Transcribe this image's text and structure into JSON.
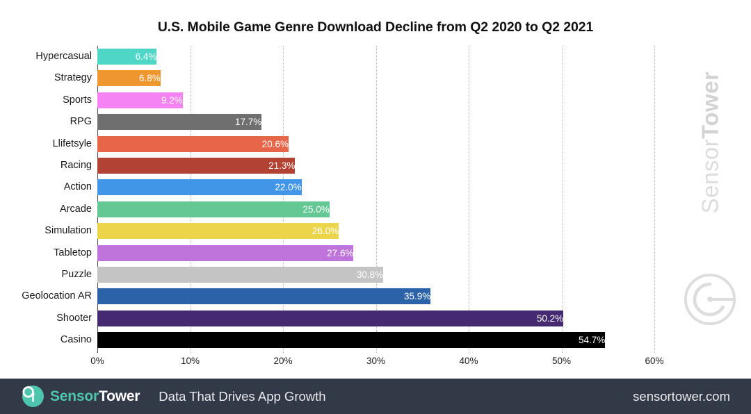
{
  "chart_data": {
    "type": "bar",
    "orientation": "horizontal",
    "title": "U.S. Mobile Game Genre Download Decline from Q2 2020 to Q2 2021",
    "xlabel": "",
    "ylabel": "",
    "xlim": [
      0,
      60
    ],
    "xticks": [
      0,
      10,
      20,
      30,
      40,
      50,
      60
    ],
    "xtick_labels": [
      "0%",
      "10%",
      "20%",
      "30%",
      "40%",
      "50%",
      "60%"
    ],
    "grid": "vertical-dotted",
    "legend": "none",
    "value_format": "percent-one-decimal",
    "categories": [
      "Hypercasual",
      "Strategy",
      "Sports",
      "RPG",
      "Llifetsyle",
      "Racing",
      "Action",
      "Arcade",
      "Simulation",
      "Tabletop",
      "Puzzle",
      "Geolocation AR",
      "Shooter",
      "Casino"
    ],
    "values": [
      6.4,
      6.8,
      9.2,
      17.7,
      20.6,
      21.3,
      22.0,
      25.0,
      26.0,
      27.6,
      30.8,
      35.9,
      50.2,
      54.7
    ],
    "value_labels": [
      "6.4%",
      "6.8%",
      "9.2%",
      "17.7%",
      "20.6%",
      "21.3%",
      "22.0%",
      "25.0%",
      "26.0%",
      "27.6%",
      "30.8%",
      "35.9%",
      "50.2%",
      "54.7%"
    ],
    "colors": [
      "#4ed6c6",
      "#ef962f",
      "#f583f3",
      "#6f6f6f",
      "#e7664a",
      "#b14234",
      "#4296e8",
      "#63c894",
      "#ecd44b",
      "#bf74dc",
      "#c4c4c4",
      "#2b62a8",
      "#452a72",
      "#000000"
    ]
  },
  "watermark": {
    "text_light": "Sensor",
    "text_bold": "Tower",
    "logo_icon": "sensortower-circle-logo-icon"
  },
  "footer": {
    "logo_icon": "sensortower-signal-logo-icon",
    "brand_first": "Sensor",
    "brand_second": "Tower",
    "tagline": "Data That Drives App Growth",
    "url": "sensortower.com",
    "background_color": "#333a47",
    "accent_color": "#4ec5ae"
  }
}
